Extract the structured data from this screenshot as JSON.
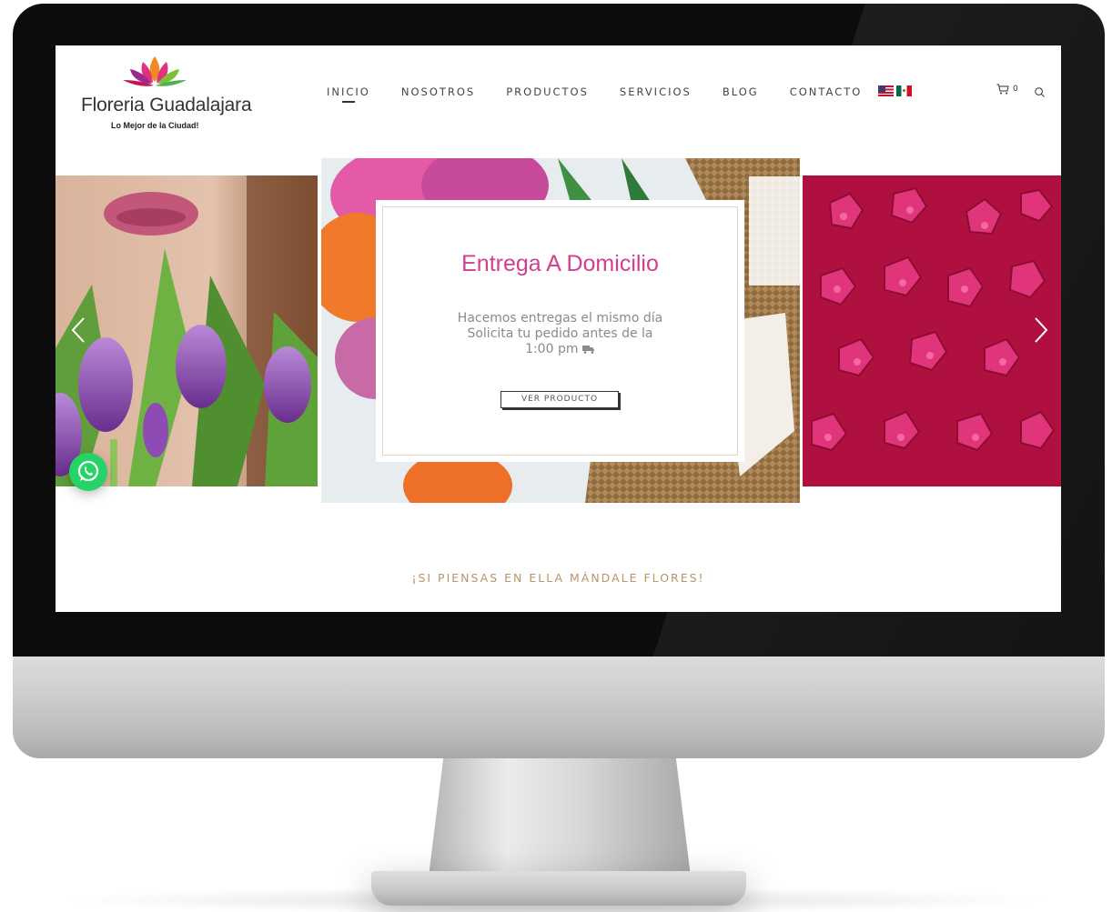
{
  "site": {
    "logo_name": "Floreria Guadalajara",
    "logo_tagline": "Lo Mejor de la Ciudad!"
  },
  "nav": {
    "items": [
      {
        "label": "INICIO",
        "active": true
      },
      {
        "label": "NOSOTROS",
        "active": false
      },
      {
        "label": "PRODUCTOS",
        "active": false
      },
      {
        "label": "SERVICIOS",
        "active": false
      },
      {
        "label": "BLOG",
        "active": false
      },
      {
        "label": "CONTACTO",
        "active": false
      }
    ],
    "languages": [
      "us-flag-icon",
      "mx-flag-icon"
    ]
  },
  "cart": {
    "count": "0",
    "icon": "cart-icon"
  },
  "search": {
    "icon": "search-icon"
  },
  "promo": {
    "title": "Entrega A Domicilio",
    "lines": [
      "Hacemos entregas el mismo día",
      "Solicita tu pedido antes de la",
      "1:00 pm"
    ],
    "button": "VER PRODUCTO"
  },
  "slider": {
    "slides": [
      "tulips-kiss-photo",
      "tulips-basket-photo",
      "pink-hydrangea-photo"
    ],
    "prev_icon": "chevron-left-icon",
    "next_icon": "chevron-right-icon"
  },
  "whatsapp": {
    "icon": "whatsapp-icon"
  },
  "footer_tagline": "¡SI PIENSAS EN ELLA MÁNDALE FLORES!",
  "colors": {
    "accent_pink": "#d0408f",
    "tagline_gold": "#b9936a",
    "whatsapp_green": "#25d366"
  }
}
